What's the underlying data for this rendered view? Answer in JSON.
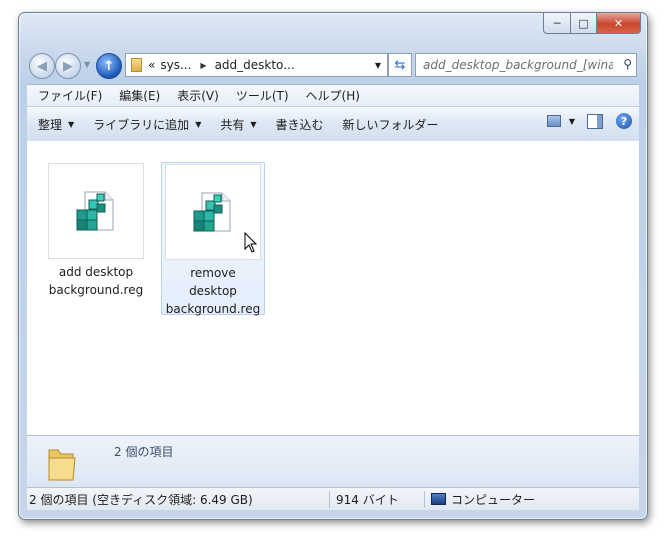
{
  "window": {
    "caption": {
      "minimize": "─",
      "maximize": "□",
      "close": "✕"
    }
  },
  "nav": {
    "address": {
      "chevrons": "«",
      "seg1": "sys...",
      "seg2": "add_deskto..."
    },
    "search_placeholder": "add_desktop_background_[winae..."
  },
  "menu": [
    "ファイル(F)",
    "編集(E)",
    "表示(V)",
    "ツール(T)",
    "ヘルプ(H)"
  ],
  "toolbar": {
    "organize": "整理",
    "library": "ライブラリに追加",
    "share": "共有",
    "burn": "書き込む",
    "new_folder": "新しいフォルダー"
  },
  "files": [
    {
      "name_line1": "add desktop",
      "name_line2": "background.reg",
      "name_line3": ""
    },
    {
      "name_line1": "remove",
      "name_line2": "desktop",
      "name_line3": "background.reg"
    }
  ],
  "details": {
    "count": "2 個の項目"
  },
  "status": {
    "items": "2 個の項目 (空きディスク領域: 6.49 GB)",
    "size": "914 バイト",
    "location": "コンピューター"
  },
  "icons": {
    "back": "arrow-left-icon",
    "forward": "arrow-right-icon",
    "up": "arrow-up-icon",
    "refresh": "refresh-icon",
    "search": "search-icon",
    "help": "help-icon"
  }
}
